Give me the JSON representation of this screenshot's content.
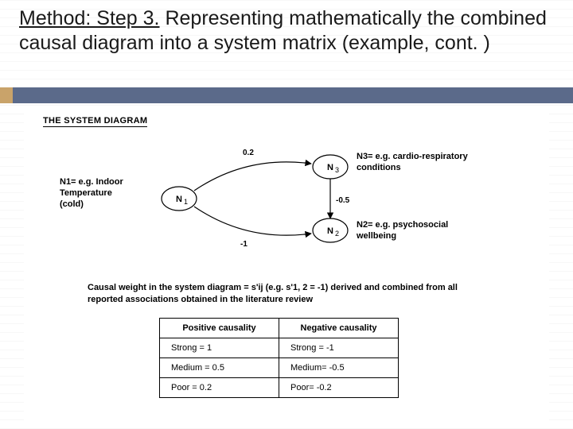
{
  "title": {
    "underlined": "Method: Step 3.",
    "rest": " Representing mathematically the combined causal diagram into a system matrix (example, cont. )"
  },
  "diagram": {
    "heading": "THE SYSTEM DIAGRAM",
    "nodes": {
      "n1": {
        "code": "N",
        "sub": "1",
        "label_line1": "N1= e.g. Indoor",
        "label_line2": "Temperature",
        "label_line3": "(cold)"
      },
      "n2": {
        "code": "N",
        "sub": "2",
        "label_line1": "N2= e.g. psychosocial",
        "label_line2": "wellbeing"
      },
      "n3": {
        "code": "N",
        "sub": "3",
        "label_line1": "N3= e.g. cardio-respiratory",
        "label_line2": "conditions"
      }
    },
    "edges": {
      "n1_n3": "0.2",
      "n1_n2": "-1",
      "n3_n2": "-0.5"
    }
  },
  "caption": "Causal weight in the system diagram = s'ij (e.g. s'1, 2 = -1) derived and combined from all reported associations obtained in the literature review",
  "table": {
    "headers": {
      "pos": "Positive  causality",
      "neg": "Negative causality"
    },
    "rows": [
      {
        "pos": "Strong = 1",
        "neg": "Strong = -1"
      },
      {
        "pos": "Medium = 0.5",
        "neg": "Medium= -0.5"
      },
      {
        "pos": "Poor = 0.2",
        "neg": "Poor= -0.2"
      }
    ]
  },
  "chart_data": {
    "type": "table",
    "title": "Causal weight coding",
    "columns": [
      "Positive causality",
      "Negative causality"
    ],
    "rows": [
      [
        "Strong = 1",
        "Strong = -1"
      ],
      [
        "Medium = 0.5",
        "Medium = -0.5"
      ],
      [
        "Poor = 0.2",
        "Poor = -0.2"
      ]
    ],
    "diagram_edges": [
      {
        "from": "N1",
        "to": "N3",
        "weight": 0.2
      },
      {
        "from": "N1",
        "to": "N2",
        "weight": -1
      },
      {
        "from": "N3",
        "to": "N2",
        "weight": -0.5
      }
    ]
  }
}
